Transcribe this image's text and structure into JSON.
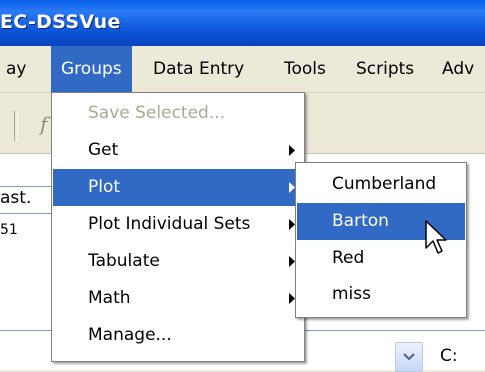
{
  "window": {
    "title": "EC-DSSVue"
  },
  "menubar": {
    "items": [
      {
        "label": "ay"
      },
      {
        "label": "Groups"
      },
      {
        "label": "Data Entry"
      },
      {
        "label": "Tools"
      },
      {
        "label": "Scripts"
      },
      {
        "label": "Adv"
      }
    ]
  },
  "groups_menu": {
    "items": [
      {
        "label": "Save Selected...",
        "enabled": false,
        "submenu": false
      },
      {
        "label": "Get",
        "enabled": true,
        "submenu": true
      },
      {
        "label": "Plot",
        "enabled": true,
        "submenu": true,
        "highlighted": true
      },
      {
        "label": "Plot Individual Sets",
        "enabled": true,
        "submenu": true
      },
      {
        "label": "Tabulate",
        "enabled": true,
        "submenu": true
      },
      {
        "label": "Math",
        "enabled": true,
        "submenu": true
      },
      {
        "label": "Manage...",
        "enabled": true,
        "submenu": false
      }
    ]
  },
  "plot_submenu": {
    "items": [
      {
        "label": "Cumberland"
      },
      {
        "label": "Barton",
        "highlighted": true
      },
      {
        "label": "Red"
      },
      {
        "label": "miss"
      }
    ]
  },
  "background": {
    "field_text": "ast.",
    "value_text": "51",
    "bottom_label": "C:"
  },
  "colors": {
    "titlebar": "#0a5fe8",
    "highlight": "#316ac5",
    "menu_bg": "#ece9d8",
    "disabled_text": "#aca899"
  },
  "icons": {
    "submenu_arrow": "triangle-right-icon",
    "combo_arrow": "chevron-down-icon",
    "cursor": "mouse-pointer-icon"
  }
}
